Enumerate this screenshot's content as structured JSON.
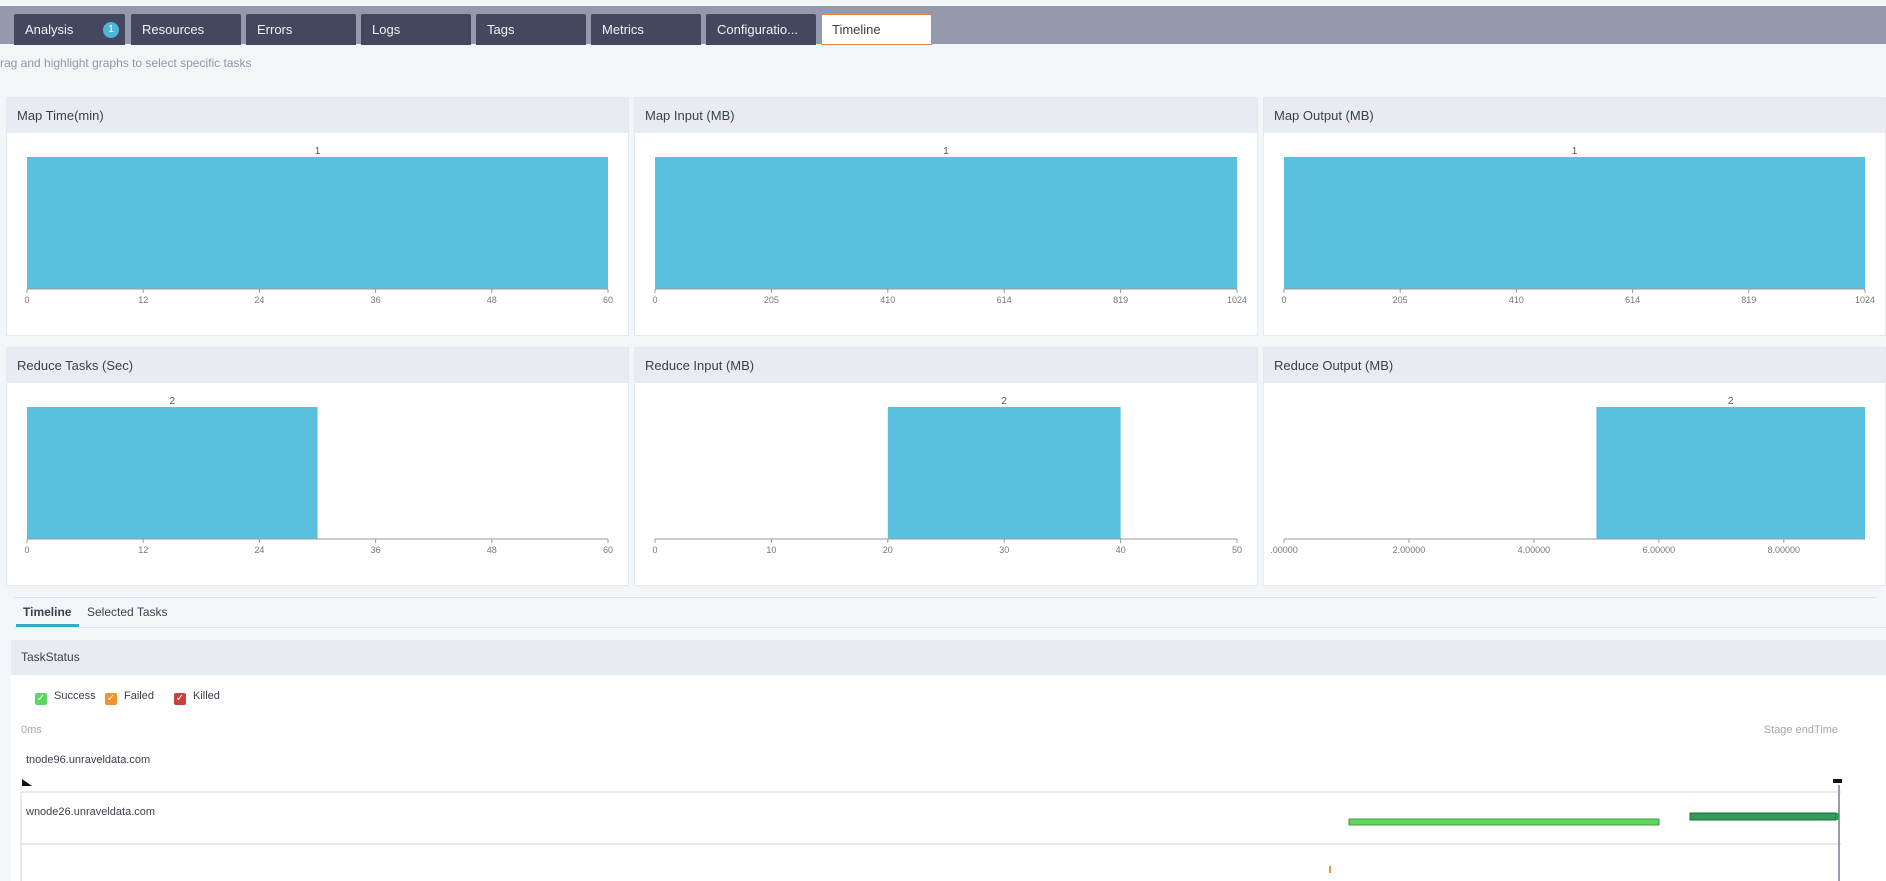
{
  "tabs": [
    {
      "label": "Analysis",
      "badge": "1"
    },
    {
      "label": "Resources"
    },
    {
      "label": "Errors"
    },
    {
      "label": "Logs"
    },
    {
      "label": "Tags"
    },
    {
      "label": "Metrics"
    },
    {
      "label": "Configuratio..."
    },
    {
      "label": "Timeline"
    }
  ],
  "hint": "rag and highlight graphs to select specific tasks",
  "colors": {
    "bar": "#5bc0de",
    "success": "#5fd75f",
    "success_dark": "#2f9e59",
    "failed": "#f0932b",
    "killed": "#c9403f",
    "tab_active_border": "#e8843f"
  },
  "chart_data": [
    {
      "type": "bar",
      "title": "Map Time(min)",
      "bins": [
        [
          0,
          60
        ]
      ],
      "counts": [
        1
      ],
      "xticks": [
        "0",
        "12",
        "24",
        "36",
        "48",
        "60"
      ],
      "xlim": [
        0,
        60
      ]
    },
    {
      "type": "bar",
      "title": "Map Input (MB)",
      "bins": [
        [
          0,
          1024
        ]
      ],
      "counts": [
        1
      ],
      "xticks": [
        "0",
        "205",
        "410",
        "614",
        "819",
        "1024"
      ],
      "xlim": [
        0,
        1024
      ]
    },
    {
      "type": "bar",
      "title": "Map Output (MB)",
      "bins": [
        [
          0,
          1024
        ]
      ],
      "counts": [
        1
      ],
      "xticks": [
        "0",
        "205",
        "410",
        "614",
        "819",
        "1024"
      ],
      "xlim": [
        0,
        1024
      ]
    },
    {
      "type": "bar",
      "title": "Reduce Tasks (Sec)",
      "bins": [
        [
          0,
          30
        ]
      ],
      "counts": [
        2
      ],
      "xticks": [
        "0",
        "12",
        "24",
        "36",
        "48",
        "60"
      ],
      "xlim": [
        0,
        60
      ]
    },
    {
      "type": "bar",
      "title": "Reduce Input (MB)",
      "bins": [
        [
          20,
          40
        ]
      ],
      "counts": [
        2
      ],
      "xticks": [
        "0",
        "10",
        "20",
        "30",
        "40",
        "50"
      ],
      "xlim": [
        0,
        50
      ]
    },
    {
      "type": "bar",
      "title": "Reduce Output (MB)",
      "bins": [
        [
          5,
          9.3
        ]
      ],
      "counts": [
        2
      ],
      "xticks": [
        ".00000",
        "2.00000",
        "4.00000",
        "6.00000",
        "8.00000"
      ],
      "xlim": [
        0,
        9.3
      ]
    }
  ],
  "subtabs": [
    "Timeline",
    "Selected Tasks"
  ],
  "task_status": {
    "title": "TaskStatus",
    "legend": [
      {
        "label": "Success",
        "color": "#5fd75f"
      },
      {
        "label": "Failed",
        "color": "#f0932b"
      },
      {
        "label": "Killed",
        "color": "#c9403f"
      }
    ],
    "axis_start": "0ms",
    "axis_end": "Stage endTime",
    "nodes": [
      "tnode96.unraveldata.com",
      "wnode26.unraveldata.com"
    ]
  }
}
